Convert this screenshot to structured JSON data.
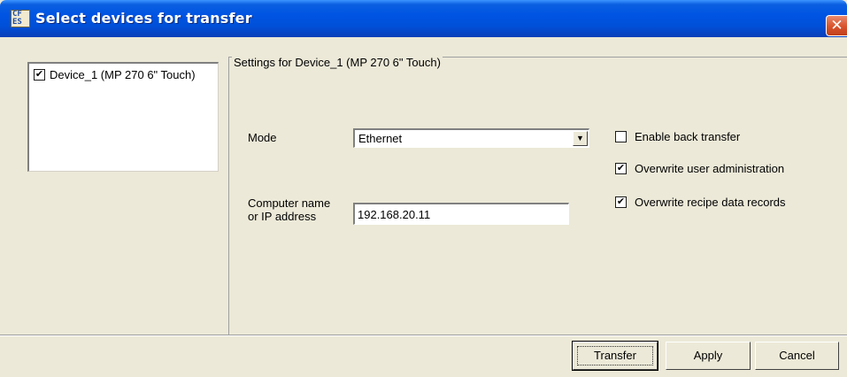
{
  "window": {
    "title": "Select devices for transfer",
    "icon_text": [
      "CF",
      "ES"
    ],
    "close_glyph": "✕"
  },
  "device_list": {
    "items": [
      {
        "label": "Device_1 (MP 270 6\" Touch)",
        "checked": true,
        "check_glyph": "✔"
      }
    ]
  },
  "settings": {
    "group_title": "Settings for Device_1 (MP 270 6\" Touch)",
    "mode_label": "Mode",
    "mode_value": "Ethernet",
    "mode_arrow": "▼",
    "computer_label_line1": "Computer name",
    "computer_label_line2": "or IP address",
    "computer_value": "192.168.20.11",
    "options": [
      {
        "label": "Enable back transfer",
        "checked": false,
        "glyph": ""
      },
      {
        "label": "Overwrite user administration",
        "checked": true,
        "glyph": "✔"
      },
      {
        "label": "Overwrite recipe data records",
        "checked": true,
        "glyph": "✔"
      }
    ]
  },
  "buttons": {
    "transfer": "Transfer",
    "apply": "Apply",
    "cancel": "Cancel"
  }
}
